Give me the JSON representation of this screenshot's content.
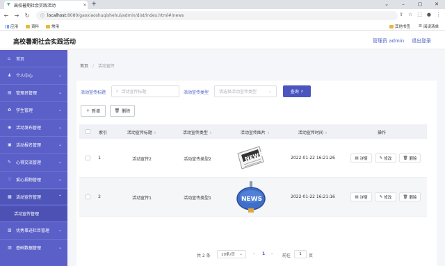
{
  "browser": {
    "tab_title": "高校暑期社会实践活动",
    "tab_close": "×",
    "new_tab": "+",
    "url_host": "localhost",
    "url_rest": ":8080/gaoxiaoshuqishehui/admin/dist/index.html#/news",
    "bookmarks": [
      "应用",
      "资料",
      "常用"
    ],
    "bookmarks_right": [
      "其他书签",
      "阅读清单"
    ]
  },
  "header": {
    "title": "高校暑期社会实践活动",
    "user": "管理员 admin",
    "logout": "退出登录"
  },
  "sidebar": {
    "items": [
      {
        "label": "首页",
        "icon": "⌂",
        "arrow": ""
      },
      {
        "label": "个人中心",
        "icon": "♟",
        "arrow": "⌄"
      },
      {
        "label": "管理员管理",
        "icon": "▤",
        "arrow": "⌄"
      },
      {
        "label": "学生管理",
        "icon": "✿",
        "arrow": "⌄"
      },
      {
        "label": "活动发布管理",
        "icon": "◉",
        "arrow": "⌄"
      },
      {
        "label": "活动报名管理",
        "icon": "▣",
        "arrow": "⌄"
      },
      {
        "label": "心得交流管理",
        "icon": "✎",
        "arrow": "⌄"
      },
      {
        "label": "爱心捐物管理",
        "icon": "♡",
        "arrow": "⌄"
      },
      {
        "label": "活动宣传管理",
        "icon": "▦",
        "arrow": "⌃"
      },
      {
        "label": "优秀事迹栏目管理",
        "icon": "▧",
        "arrow": "⌄"
      },
      {
        "label": "基础数据管理",
        "icon": "▥",
        "arrow": "⌄"
      }
    ],
    "submenu_active": "活动宣传管理"
  },
  "breadcrumb": {
    "home": "首页",
    "sep": "/",
    "current": "活动宣传"
  },
  "search": {
    "title_label": "活动宣传标题",
    "title_placeholder": "活动宣传标题",
    "type_label": "活动宣传类型",
    "type_placeholder": "请选择活动宣传类型",
    "query_button": "查询"
  },
  "actions": {
    "add": "新增",
    "delete": "删除"
  },
  "table": {
    "headers": [
      "索引",
      "活动宣传标题",
      "活动宣传类型",
      "活动宣传图片",
      "活动宣传时间",
      "操作"
    ],
    "rows": [
      {
        "index": "1",
        "title": "活动宣传2",
        "type": "活动宣传类型2",
        "time": "2022-01-22 16:21:26",
        "image": "news-paper"
      },
      {
        "index": "2",
        "title": "活动宣传1",
        "type": "活动宣传类型1",
        "time": "2022-01-22 16:21:16",
        "image": "news-sign"
      }
    ],
    "row_buttons": {
      "detail": "详情",
      "edit": "修改",
      "delete": "删除"
    }
  },
  "pagination": {
    "total": "共 2 条",
    "page_size": "10条/页",
    "current_page": "1",
    "goto_label": "前往",
    "goto_value": "1",
    "page_unit": "页"
  },
  "colors": {
    "sidebar": "#5a60c8",
    "accent": "#4a55c0"
  }
}
